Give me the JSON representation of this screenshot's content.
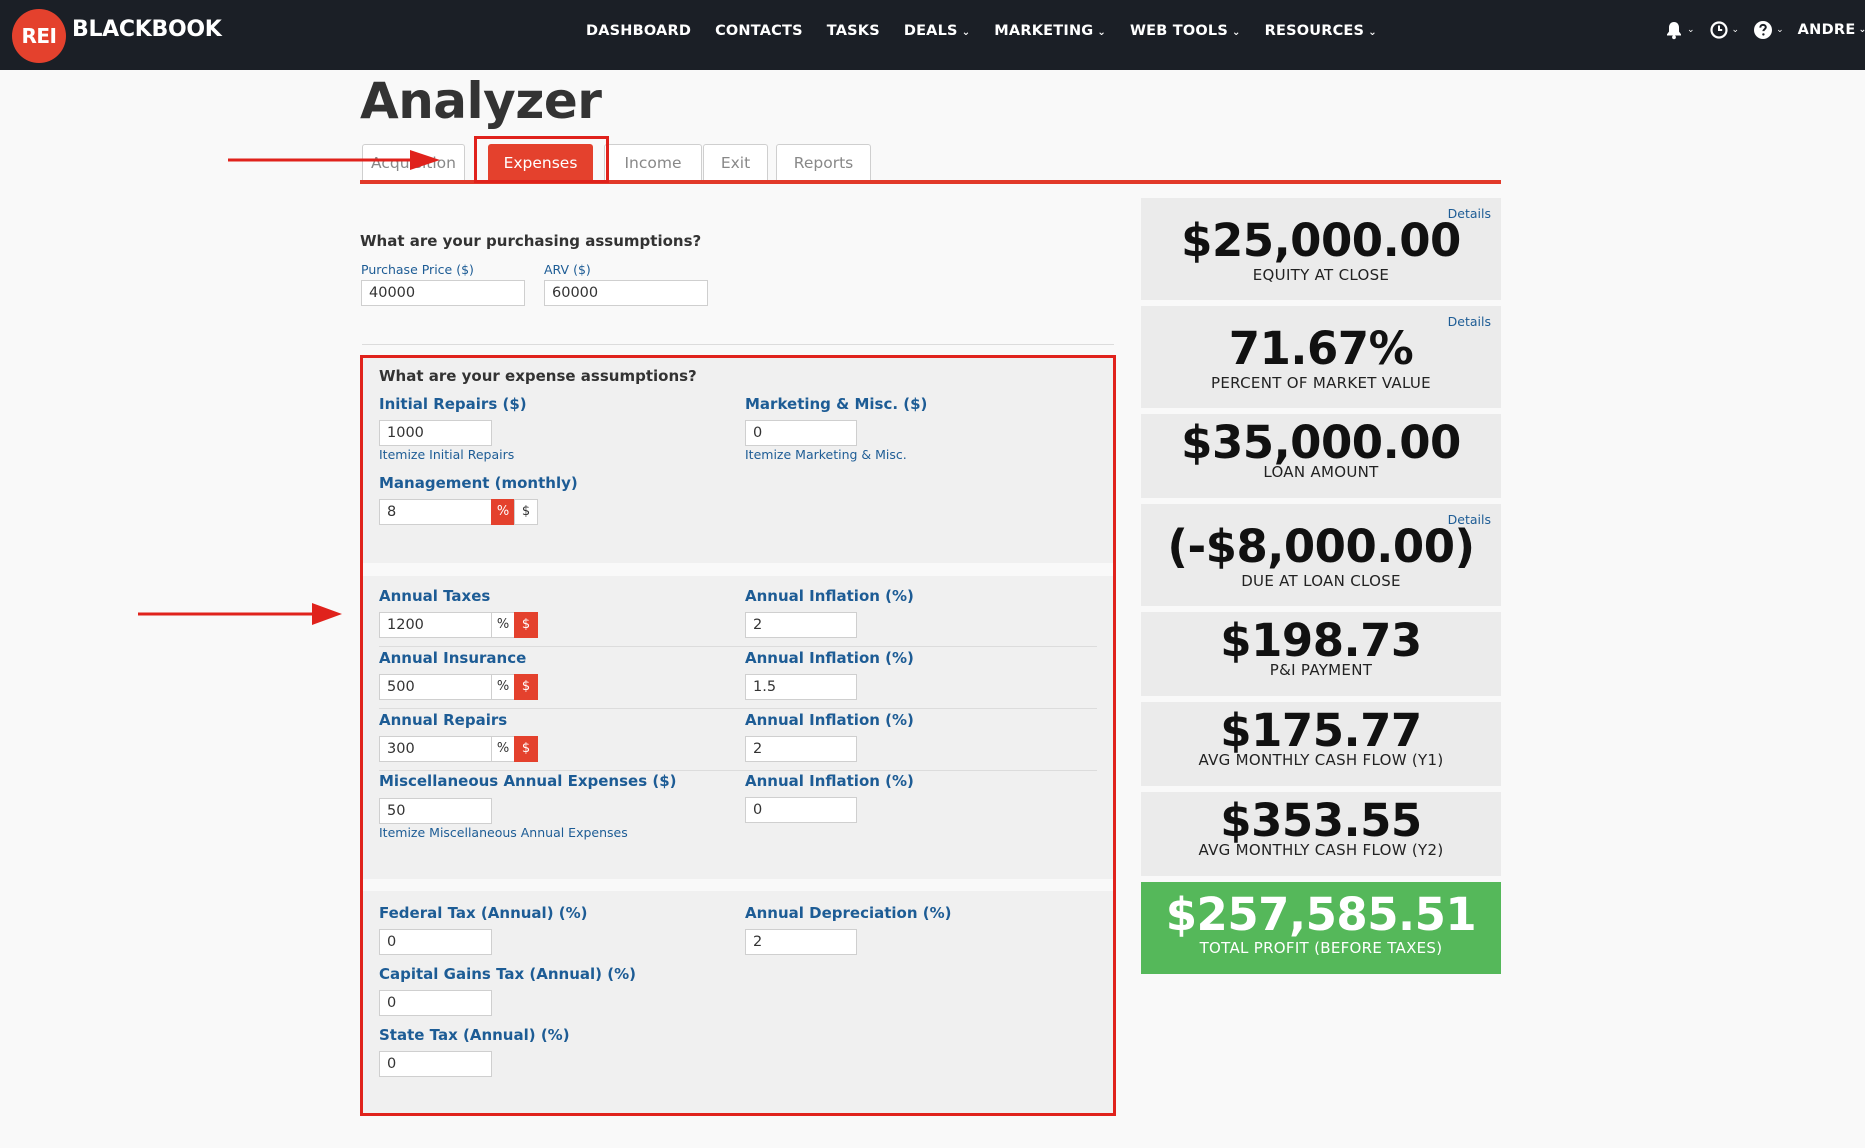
{
  "brand": {
    "logo_badge": "REI",
    "logo_text": "BLACKBOOK"
  },
  "nav": {
    "items": [
      {
        "label": "DASHBOARD",
        "has_caret": false
      },
      {
        "label": "CONTACTS",
        "has_caret": false
      },
      {
        "label": "TASKS",
        "has_caret": false
      },
      {
        "label": "DEALS",
        "has_caret": true
      },
      {
        "label": "MARKETING",
        "has_caret": true
      },
      {
        "label": "WEB TOOLS",
        "has_caret": true
      },
      {
        "label": "RESOURCES",
        "has_caret": true
      }
    ],
    "caret": "⌄",
    "user": "ANDRE"
  },
  "page": {
    "title": "Analyzer"
  },
  "tabs": [
    {
      "label": "Acquisition",
      "active": false
    },
    {
      "label": "Expenses",
      "active": true
    },
    {
      "label": "Income",
      "active": false
    },
    {
      "label": "Exit",
      "active": false
    },
    {
      "label": "Reports",
      "active": false
    }
  ],
  "purchasing": {
    "question": "What are your purchasing assumptions?",
    "purchase_price_label": "Purchase Price ($)",
    "purchase_price": "40000",
    "arv_label": "ARV ($)",
    "arv": "60000"
  },
  "expenses": {
    "question": "What are your expense assumptions?",
    "initial_repairs_label": "Initial Repairs ($)",
    "initial_repairs": "1000",
    "initial_repairs_link": "Itemize Initial Repairs",
    "marketing_label": "Marketing & Misc. ($)",
    "marketing": "0",
    "marketing_link": "Itemize Marketing & Misc.",
    "management_label": "Management (monthly)",
    "management": "8",
    "management_mode": "%",
    "annual_taxes_label": "Annual Taxes",
    "annual_taxes": "1200",
    "annual_taxes_mode": "$",
    "taxes_inflation_label": "Annual Inflation (%)",
    "taxes_inflation": "2",
    "annual_insurance_label": "Annual Insurance",
    "annual_insurance": "500",
    "annual_insurance_mode": "$",
    "insurance_inflation_label": "Annual Inflation (%)",
    "insurance_inflation": "1.5",
    "annual_repairs_label": "Annual Repairs",
    "annual_repairs": "300",
    "annual_repairs_mode": "$",
    "repairs_inflation_label": "Annual Inflation (%)",
    "repairs_inflation": "2",
    "misc_label": "Miscellaneous Annual Expenses ($)",
    "misc": "50",
    "misc_link": "Itemize Miscellaneous Annual Expenses",
    "misc_inflation_label": "Annual Inflation (%)",
    "misc_inflation": "0",
    "federal_tax_label": "Federal Tax (Annual) (%)",
    "federal_tax": "0",
    "depreciation_label": "Annual Depreciation (%)",
    "depreciation": "2",
    "cap_gains_label": "Capital Gains Tax (Annual) (%)",
    "cap_gains": "0",
    "state_tax_label": "State Tax (Annual) (%)",
    "state_tax": "0",
    "toggle_pct": "%",
    "toggle_usd": "$"
  },
  "summary": {
    "details_label": "Details",
    "cards": [
      {
        "value": "$25,000.00",
        "label": "EQUITY AT CLOSE",
        "details": true
      },
      {
        "value": "71.67%",
        "label": "PERCENT OF MARKET VALUE",
        "details": true
      },
      {
        "value": "$35,000.00",
        "label": "LOAN AMOUNT",
        "details": false
      },
      {
        "value": "(-$8,000.00)",
        "label": "DUE AT LOAN CLOSE",
        "details": true
      },
      {
        "value": "$198.73",
        "label": "P&I PAYMENT",
        "details": false
      },
      {
        "value": "$175.77",
        "label": "AVG MONTHLY CASH FLOW (Y1)",
        "details": false
      },
      {
        "value": "$353.55",
        "label": "AVG MONTHLY CASH FLOW (Y2)",
        "details": false
      },
      {
        "value": "$257,585.51",
        "label": "TOTAL PROFIT (BEFORE TAXES)",
        "details": false
      }
    ]
  },
  "colors": {
    "topbar": "#1b1f26",
    "accent": "#e4412d",
    "label_blue": "#1d5c95",
    "profit_green": "#55b85a",
    "annotation_red": "#e0221c"
  }
}
